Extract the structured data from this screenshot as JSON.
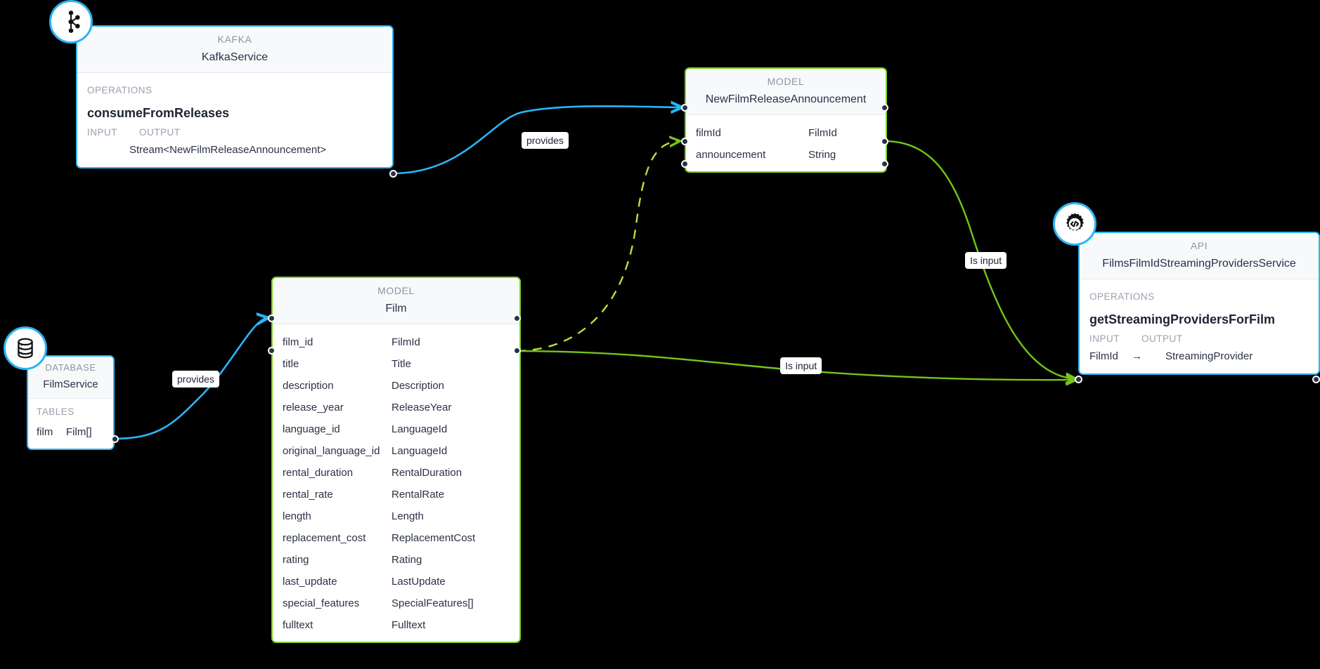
{
  "canvas": {
    "background": "#000000"
  },
  "palette": {
    "blue": "#29b6f6",
    "green": "#7ed321",
    "edge_blue": "#29b6f6",
    "edge_green": "#76c41a",
    "edge_dashed": "#c7d83a",
    "card": "#ffffff",
    "header": "#f7f9fb",
    "text": "#2b3147",
    "muted": "#9aa0ae",
    "port": "#2b3147"
  },
  "nodes": {
    "kafka": {
      "icon": "kafka-icon",
      "kind": "KAFKA",
      "title": "KafkaService",
      "section": "OPERATIONS",
      "operation": "consumeFromReleases",
      "input_header": "INPUT",
      "output_header": "OUTPUT",
      "input_value": "",
      "output_value": "Stream<NewFilmReleaseAnnouncement>"
    },
    "database": {
      "icon": "database-icon",
      "kind": "DATABASE",
      "title": "FilmService",
      "section": "TABLES",
      "rows": [
        {
          "name": "film",
          "type": "Film[]"
        }
      ]
    },
    "film_model": {
      "kind": "MODEL",
      "title": "Film",
      "rows": [
        {
          "name": "film_id",
          "type": "FilmId"
        },
        {
          "name": "title",
          "type": "Title"
        },
        {
          "name": "description",
          "type": "Description"
        },
        {
          "name": "release_year",
          "type": "ReleaseYear"
        },
        {
          "name": "language_id",
          "type": "LanguageId"
        },
        {
          "name": "original_language_id",
          "type": "LanguageId"
        },
        {
          "name": "rental_duration",
          "type": "RentalDuration"
        },
        {
          "name": "rental_rate",
          "type": "RentalRate"
        },
        {
          "name": "length",
          "type": "Length"
        },
        {
          "name": "replacement_cost",
          "type": "ReplacementCost"
        },
        {
          "name": "rating",
          "type": "Rating"
        },
        {
          "name": "last_update",
          "type": "LastUpdate"
        },
        {
          "name": "special_features",
          "type": "SpecialFeatures[]"
        },
        {
          "name": "fulltext",
          "type": "Fulltext"
        }
      ]
    },
    "announcement_model": {
      "kind": "MODEL",
      "title": "NewFilmReleaseAnnouncement",
      "rows": [
        {
          "name": "filmId",
          "type": "FilmId"
        },
        {
          "name": "announcement",
          "type": "String"
        }
      ]
    },
    "api": {
      "icon": "api-gear-code-icon",
      "kind": "API",
      "title": "FilmsFilmIdStreamingProvidersService",
      "section": "OPERATIONS",
      "operation": "getStreamingProvidersForFilm",
      "input_header": "INPUT",
      "output_header": "OUTPUT",
      "input_value": "FilmId",
      "arrow": "→",
      "output_value": "StreamingProvider"
    }
  },
  "edges": [
    {
      "id": "kafka-to-announcement",
      "label": "provides",
      "style": "solid",
      "color": "#29b6f6"
    },
    {
      "id": "database-to-film",
      "label": "provides",
      "style": "solid",
      "color": "#29b6f6"
    },
    {
      "id": "film-to-announcement-filmid",
      "label": "",
      "style": "dashed",
      "color": "#c7d83a"
    },
    {
      "id": "announcement-filmid-to-api",
      "label": "Is input",
      "style": "solid",
      "color": "#76c41a"
    },
    {
      "id": "film-filmid-to-api",
      "label": "Is input",
      "style": "solid",
      "color": "#76c41a"
    }
  ]
}
